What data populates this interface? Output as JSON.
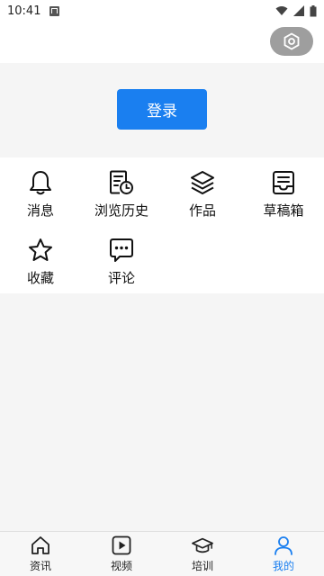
{
  "status_bar": {
    "time": "10:41"
  },
  "header": {
    "settings_icon": "settings-hex-icon"
  },
  "login": {
    "label": "登录"
  },
  "menu": {
    "items": [
      {
        "label": "消息",
        "icon": "bell-icon"
      },
      {
        "label": "浏览历史",
        "icon": "history-icon"
      },
      {
        "label": "作品",
        "icon": "layers-icon"
      },
      {
        "label": "草稿箱",
        "icon": "drafts-icon"
      },
      {
        "label": "收藏",
        "icon": "star-icon"
      },
      {
        "label": "评论",
        "icon": "comment-icon"
      }
    ]
  },
  "tabs": [
    {
      "label": "资讯",
      "icon": "home-icon",
      "active": false
    },
    {
      "label": "视频",
      "icon": "video-icon",
      "active": false
    },
    {
      "label": "培训",
      "icon": "graduation-cap-icon",
      "active": false
    },
    {
      "label": "我的",
      "icon": "user-icon",
      "active": true
    }
  ],
  "colors": {
    "accent": "#1a7ff0",
    "settings_bg": "#9e9e9e"
  }
}
